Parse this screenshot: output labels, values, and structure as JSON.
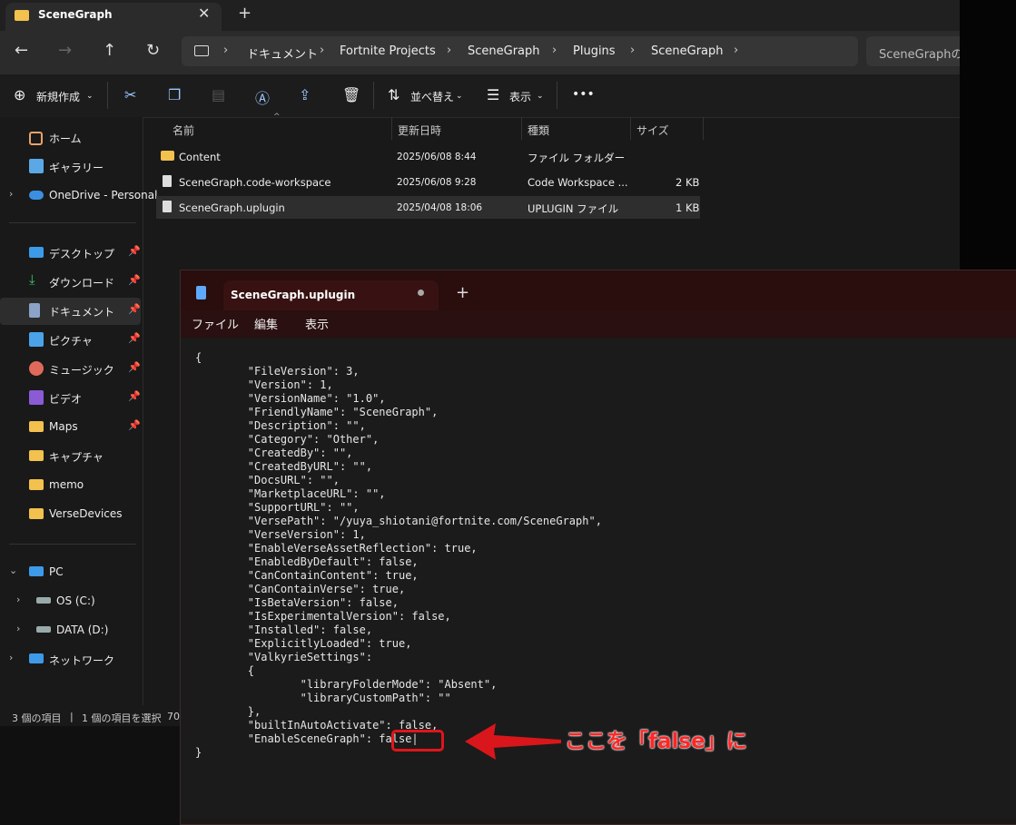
{
  "explorer": {
    "tab_title": "SceneGraph",
    "close_glyph": "✕",
    "newtab_glyph": "+",
    "breadcrumb": [
      "ドキュメント",
      "Fortnite Projects",
      "SceneGraph",
      "Plugins",
      "SceneGraph"
    ],
    "search_placeholder": "SceneGraphの検索",
    "commands": {
      "new": "新規作成",
      "sort": "並べ替え",
      "view": "表示"
    },
    "sidebar": [
      {
        "label": "ホーム",
        "icon": "home-icon"
      },
      {
        "label": "ギャラリー",
        "icon": "gallery-icon"
      },
      {
        "label": "OneDrive - Personal",
        "icon": "cloud-icon"
      },
      {
        "label": "デスクトップ",
        "icon": "desktop-icon"
      },
      {
        "label": "ダウンロード",
        "icon": "download-icon"
      },
      {
        "label": "ドキュメント",
        "icon": "document-icon"
      },
      {
        "label": "ピクチャ",
        "icon": "pictures-icon"
      },
      {
        "label": "ミュージック",
        "icon": "music-icon"
      },
      {
        "label": "ビデオ",
        "icon": "video-icon"
      },
      {
        "label": "Maps",
        "icon": "folder-icon"
      },
      {
        "label": "キャプチャ",
        "icon": "folder-icon"
      },
      {
        "label": "memo",
        "icon": "folder-icon"
      },
      {
        "label": "VerseDevices",
        "icon": "folder-icon"
      },
      {
        "label": "PC",
        "icon": "pc-icon"
      },
      {
        "label": "OS (C:)",
        "icon": "drive-icon"
      },
      {
        "label": "DATA (D:)",
        "icon": "drive-icon"
      },
      {
        "label": "ネットワーク",
        "icon": "network-icon"
      }
    ],
    "columns": [
      "名前",
      "更新日時",
      "種類",
      "サイズ"
    ],
    "files": [
      {
        "name": "Content",
        "date": "2025/06/08 8:44",
        "type": "ファイル フォルダー",
        "size": ""
      },
      {
        "name": "SceneGraph.code-workspace",
        "date": "2025/06/08 9:28",
        "type": "Code Workspace ...",
        "size": "2 KB"
      },
      {
        "name": "SceneGraph.uplugin",
        "date": "2025/04/08 18:06",
        "type": "UPLUGIN ファイル",
        "size": "1 KB"
      }
    ],
    "status": {
      "count": "3 個の項目",
      "selected": "1 個の項目を選択",
      "extra": "70"
    }
  },
  "notepad": {
    "tab_title": "SceneGraph.uplugin",
    "newtab_glyph": "+",
    "menu": [
      "ファイル",
      "編集",
      "表示"
    ],
    "content": "{\n\t\"FileVersion\": 3,\n\t\"Version\": 1,\n\t\"VersionName\": \"1.0\",\n\t\"FriendlyName\": \"SceneGraph\",\n\t\"Description\": \"\",\n\t\"Category\": \"Other\",\n\t\"CreatedBy\": \"\",\n\t\"CreatedByURL\": \"\",\n\t\"DocsURL\": \"\",\n\t\"MarketplaceURL\": \"\",\n\t\"SupportURL\": \"\",\n\t\"VersePath\": \"/yuya_shiotani@fortnite.com/SceneGraph\",\n\t\"VerseVersion\": 1,\n\t\"EnableVerseAssetReflection\": true,\n\t\"EnabledByDefault\": false,\n\t\"CanContainContent\": true,\n\t\"CanContainVerse\": true,\n\t\"IsBetaVersion\": false,\n\t\"IsExperimentalVersion\": false,\n\t\"Installed\": false,\n\t\"ExplicitlyLoaded\": true,\n\t\"ValkyrieSettings\":\n\t{\n\t\t\"libraryFolderMode\": \"Absent\",\n\t\t\"libraryCustomPath\": \"\"\n\t},\n\t\"builtInAutoActivate\": false,\n\t\"EnableSceneGraph\": false|\n}"
  },
  "annotation": {
    "text": "ここを「false」に",
    "color": "#ff2727"
  }
}
